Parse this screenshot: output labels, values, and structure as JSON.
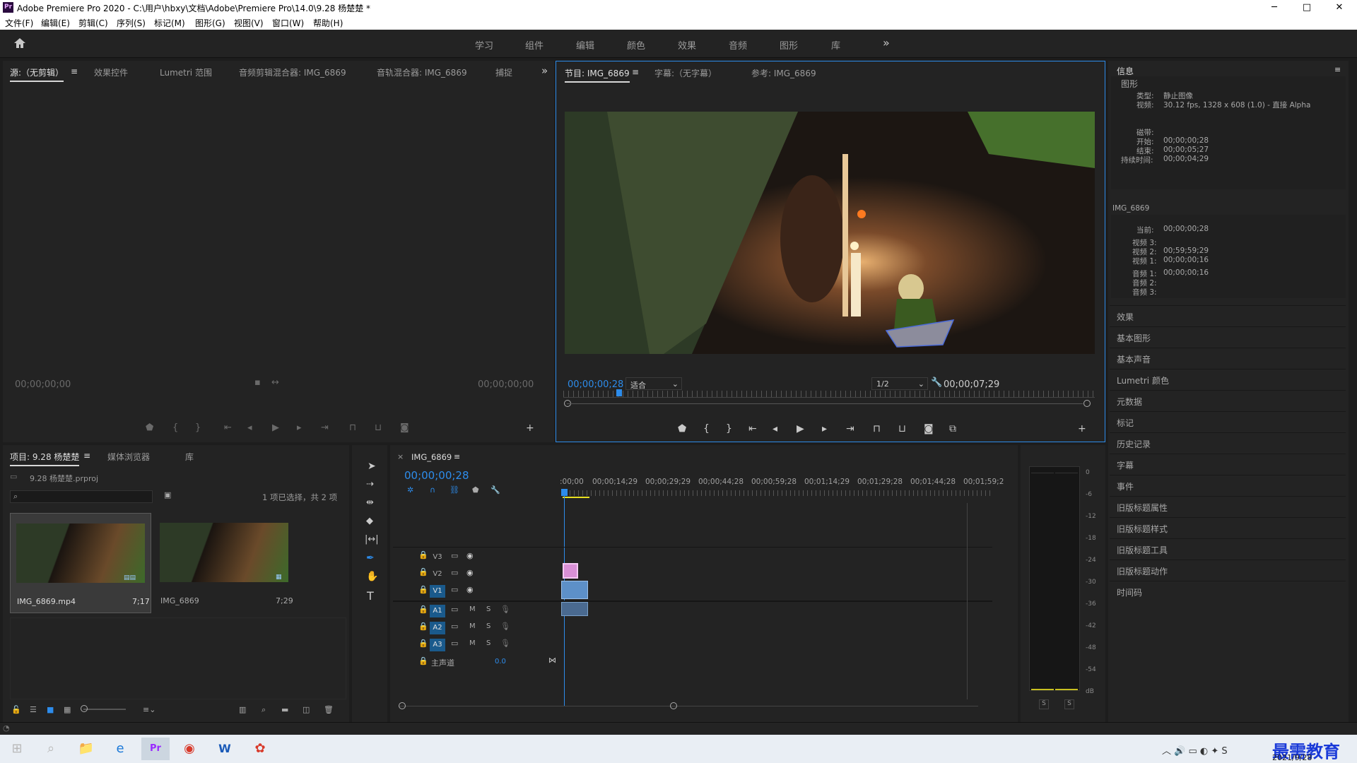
{
  "window": {
    "title": "Adobe Premiere Pro 2020 - C:\\用户\\hbxy\\文档\\Adobe\\Premiere Pro\\14.0\\9.28 杨楚楚 *",
    "app_icon": "Pr",
    "min": "─",
    "max": "□",
    "close": "✕"
  },
  "menu": [
    "文件(F)",
    "编辑(E)",
    "剪辑(C)",
    "序列(S)",
    "标记(M)",
    "图形(G)",
    "视图(V)",
    "窗口(W)",
    "帮助(H)"
  ],
  "workspaces": [
    "学习",
    "组件",
    "编辑",
    "颜色",
    "效果",
    "音频",
    "图形",
    "库"
  ],
  "workspace_more": "»",
  "source_panel": {
    "tabs": [
      "源:（无剪辑）",
      "效果控件",
      "Lumetri 范围",
      "音频剪辑混合器: IMG_6869",
      "音轨混合器: IMG_6869",
      "捕捉"
    ],
    "more": "»",
    "menu": "≡",
    "tc_left": "00;00;00;00",
    "tc_right": "00;00;00;00",
    "add": "+"
  },
  "program_panel": {
    "tabs": [
      "节目: IMG_6869",
      "字幕:（无字幕）",
      "参考: IMG_6869"
    ],
    "menu": "≡",
    "timecode": "00;00;00;28",
    "fit": "适合",
    "resolution": "1/2",
    "duration": "00;00;07;29",
    "add": "+"
  },
  "info_panel": {
    "title": "信息",
    "menu": "≡",
    "section": "图形",
    "type_label": "类型:",
    "type_value": "静止图像",
    "video_label": "视频:",
    "video_value": "30.12 fps, 1328 x 608 (1.0) - 直接 Alpha",
    "tape_label": "磁带:",
    "start_label": "开始:",
    "start_value": "00;00;00;28",
    "end_label": "结束:",
    "end_value": "00;00;05;27",
    "dur_label": "持续时间:",
    "dur_value": "00;00;04;29",
    "seq_name": "IMG_6869",
    "cur_label": "当前:",
    "cur_value": "00;00;00;28",
    "v3_label": "视频 3:",
    "v3_value": "",
    "v2_label": "视频 2:",
    "v2_value": "00;59;59;29",
    "v1_label": "视频 1:",
    "v1_value": "00;00;00;16",
    "a1_label": "音频 1:",
    "a1_value": "00;00;00;16",
    "a2_label": "音频 2:",
    "a2_value": "",
    "a3_label": "音频 3:",
    "a3_value": ""
  },
  "side_panels": [
    "效果",
    "基本图形",
    "基本声音",
    "Lumetri 颜色",
    "元数据",
    "标记",
    "历史记录",
    "字幕",
    "事件",
    "旧版标题属性",
    "旧版标题样式",
    "旧版标题工具",
    "旧版标题动作",
    "时间码"
  ],
  "project_panel": {
    "tabs": [
      "项目: 9.28 杨楚楚",
      "媒体浏览器",
      "库"
    ],
    "menu": "≡",
    "file": "9.28 杨楚楚.prproj",
    "selection": "1 项已选择，共 2 项",
    "items": [
      {
        "name": "IMG_6869.mp4",
        "dur": "7;17"
      },
      {
        "name": "IMG_6869",
        "dur": "7;29"
      }
    ]
  },
  "timeline": {
    "tab": "IMG_6869",
    "close": "×",
    "menu": "≡",
    "timecode": "00;00;00;28",
    "ruler": [
      ":00;00",
      "00;00;14;29",
      "00;00;29;29",
      "00;00;44;28",
      "00;00;59;28",
      "00;01;14;29",
      "00;01;29;28",
      "00;01;44;28",
      "00;01;59;2"
    ],
    "video_tracks": [
      "V3",
      "V2",
      "V1"
    ],
    "audio_tracks": [
      "A1",
      "A2",
      "A3"
    ],
    "master": "主声道",
    "master_val": "0.0",
    "m": "M",
    "s": "S"
  },
  "meter": {
    "labels": [
      "0",
      "-6",
      "-12",
      "-18",
      "-24",
      "-30",
      "-36",
      "-42",
      "-48",
      "-54",
      "dB"
    ],
    "solo": [
      "S",
      "S"
    ]
  },
  "taskbar": {
    "date": "2021/9/28",
    "watermark": "最需教育"
  },
  "colors": {
    "accent": "#2d8ceb",
    "panel": "#232323",
    "bg": "#1d1d1d",
    "selected_track": "#1a5a8c",
    "clip_blue": "#5d90c8",
    "clip_pink": "#d98fd6"
  }
}
